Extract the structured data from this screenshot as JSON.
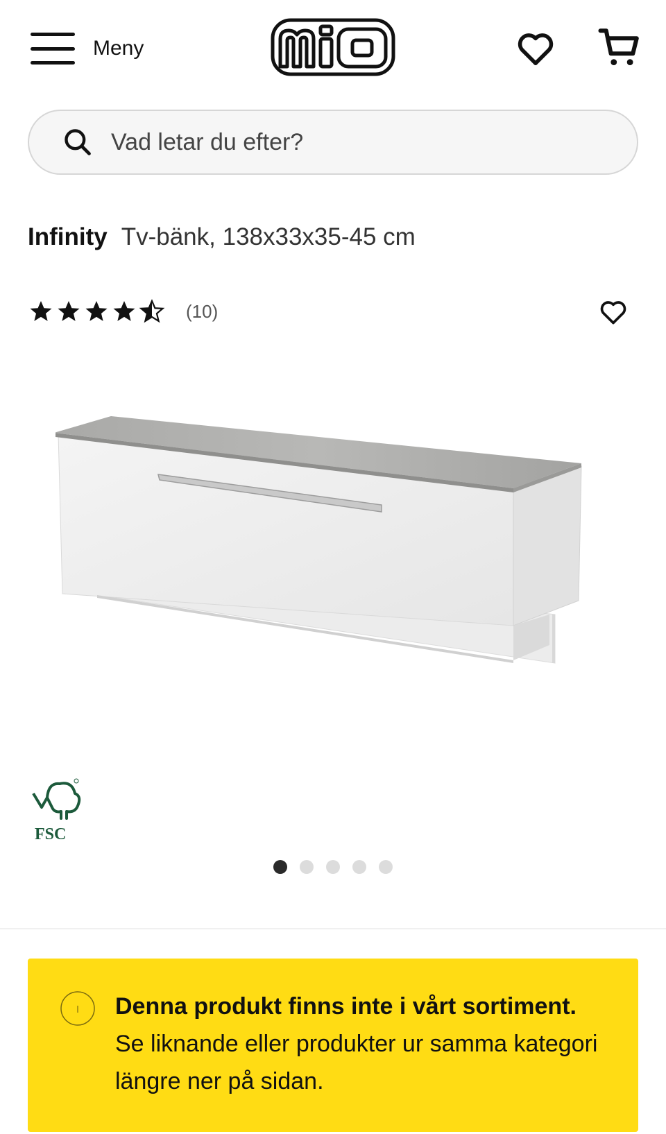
{
  "header": {
    "menu_label": "Meny",
    "logo_text": "mio",
    "icons": [
      "menu-icon",
      "heart-icon",
      "cart-icon"
    ]
  },
  "search": {
    "placeholder": "Vad letar du efter?"
  },
  "product": {
    "brand": "Infinity",
    "name": "Tv-bänk, 138x33x35-45 cm",
    "rating_stars": 4.5,
    "rating_max": 5,
    "review_count": "(10)",
    "certification": "FSC",
    "image_count": 5,
    "active_image": 1
  },
  "notice": {
    "title": "Denna produkt finns inte i vårt sortiment.",
    "body": "Se liknande eller produkter ur samma kategori längre ner på sidan."
  },
  "colors": {
    "accent_yellow": "#ffdc14",
    "text": "#111111"
  }
}
